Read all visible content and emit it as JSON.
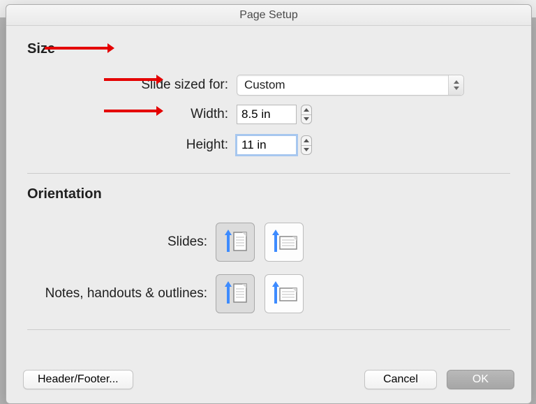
{
  "dialog": {
    "title": "Page Setup",
    "size": {
      "section_label": "Size",
      "slide_sized_label": "Slide sized for:",
      "slide_sized_value": "Custom",
      "width_label": "Width:",
      "width_value": "8.5 in",
      "height_label": "Height:",
      "height_value": "11 in"
    },
    "orientation": {
      "section_label": "Orientation",
      "slides_label": "Slides:",
      "slides_selected": "portrait",
      "notes_label": "Notes, handouts & outlines:",
      "notes_selected": "portrait"
    },
    "buttons": {
      "header_footer": "Header/Footer...",
      "cancel": "Cancel",
      "ok": "OK"
    }
  }
}
